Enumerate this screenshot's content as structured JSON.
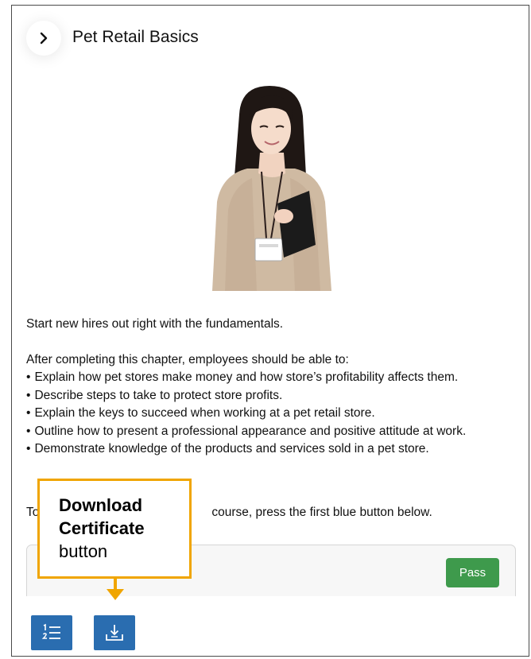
{
  "header": {
    "title": "Pet Retail Basics",
    "back_icon": "chevron-right-icon"
  },
  "content": {
    "intro": "Start new hires out right with the fundamentals.",
    "objectives_heading": "After completing this chapter, employees should be able to:",
    "objectives": [
      "Explain how pet stores make money and how store’s profitability affects them.",
      "Describe steps to take to protect store profits.",
      "Explain the keys to succeed when working at a pet retail store.",
      "Outline how to present a professional appearance and positive attitude at work.",
      "Demonstrate knowledge of the products and services sold in a pet store."
    ],
    "instruction_start": "To",
    "instruction_end": "course, press the first blue button below."
  },
  "card": {
    "status_badge": "Pass"
  },
  "toolbar": {
    "chapters_icon": "numbered-list-icon",
    "download_icon": "download-tray-icon"
  },
  "callout": {
    "line1": "Download",
    "line2": "Certificate",
    "line3": "button"
  },
  "colors": {
    "primary_blue": "#2a6db0",
    "pass_green": "#3e9a4c",
    "callout_orange": "#f0a500"
  }
}
